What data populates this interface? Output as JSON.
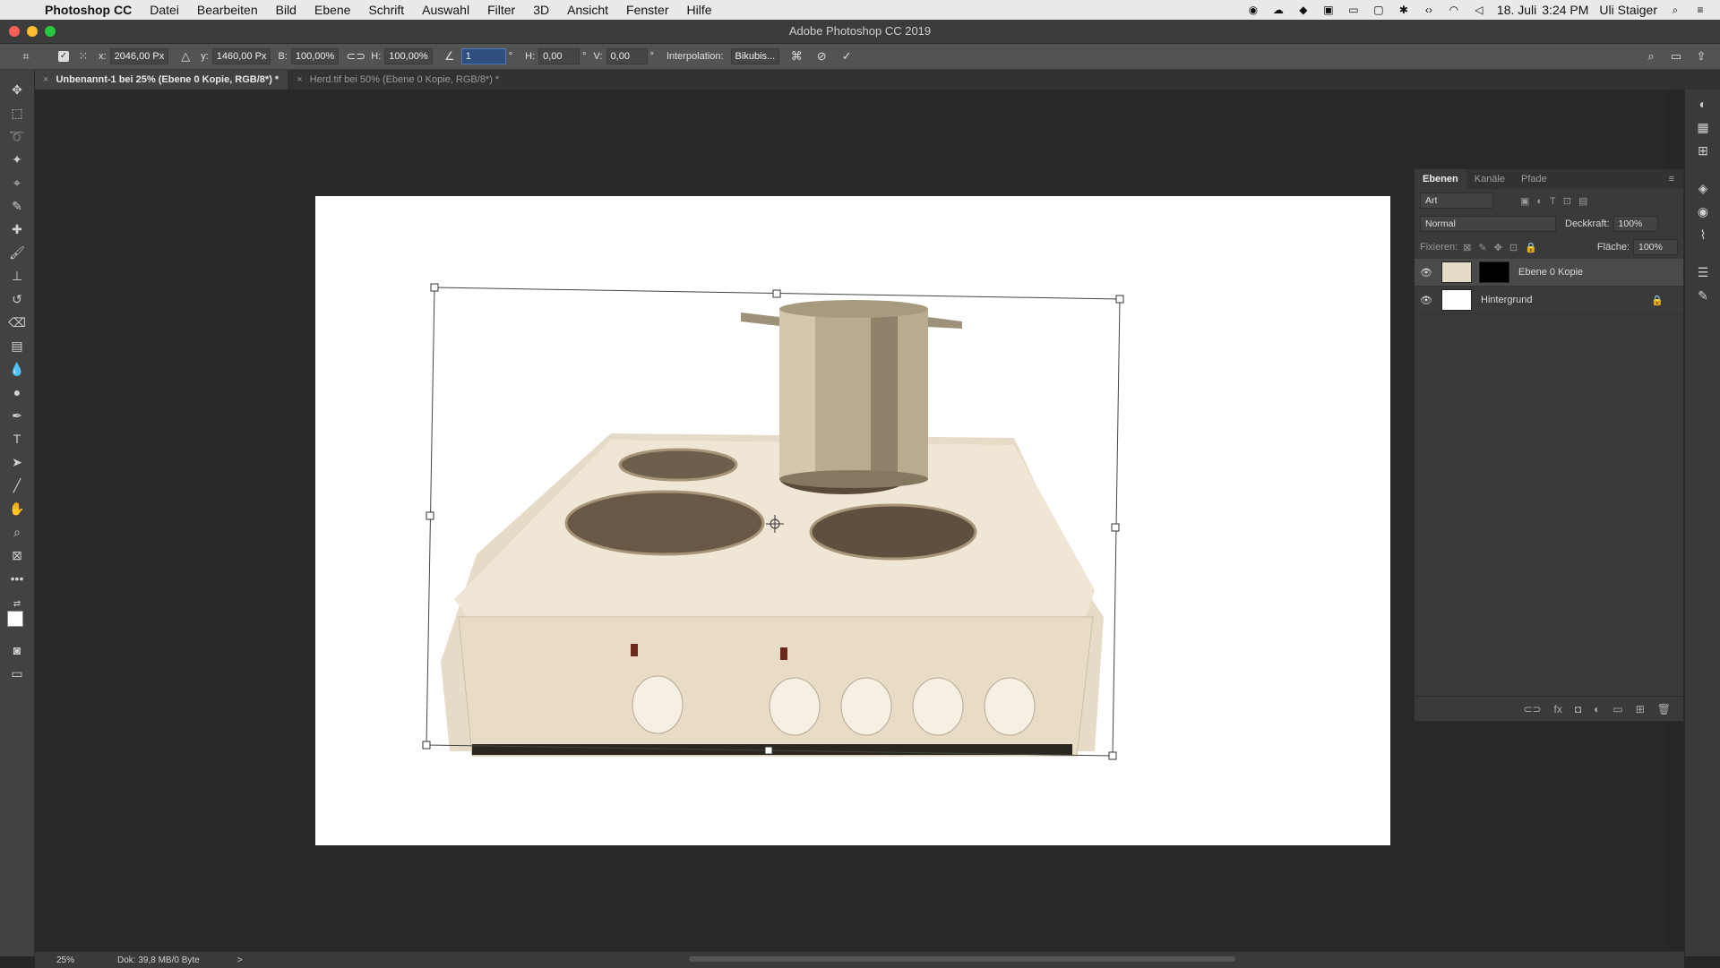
{
  "menubar": {
    "app_name": "Photoshop CC",
    "items": [
      "Datei",
      "Bearbeiten",
      "Bild",
      "Ebene",
      "Schrift",
      "Auswahl",
      "Filter",
      "3D",
      "Ansicht",
      "Fenster",
      "Hilfe"
    ],
    "date": "18. Juli",
    "time": "3:24 PM",
    "user": "Uli Staiger"
  },
  "window": {
    "title": "Adobe Photoshop CC 2019"
  },
  "options": {
    "x_label": "x:",
    "x_value": "2046,00 Px",
    "y_label": "y:",
    "y_value": "1460,00 Px",
    "w_label": "B:",
    "w_value": "100,00%",
    "h_label": "H:",
    "h_value": "100,00%",
    "angle_value": "1",
    "deg": "°",
    "hskew_label": "H:",
    "hskew_value": "0,00",
    "vskew_label": "V:",
    "vskew_value": "0,00",
    "interp_label": "Interpolation:",
    "interp_value": "Bikubis..."
  },
  "tabs": [
    {
      "label": "Unbenannt-1 bei 25% (Ebene 0 Kopie, RGB/8*) *",
      "active": true
    },
    {
      "label": "Herd.tif bei 50% (Ebene 0 Kopie, RGB/8*) *",
      "active": false
    }
  ],
  "layers_panel": {
    "tabs": [
      "Ebenen",
      "Kanäle",
      "Pfade"
    ],
    "search_placeholder": "Art",
    "blend_mode": "Normal",
    "opacity_label": "Deckkraft:",
    "opacity_value": "100%",
    "lock_label": "Fixieren:",
    "fill_label": "Fläche:",
    "fill_value": "100%",
    "layers": [
      {
        "name": "Ebene 0 Kopie",
        "selected": true
      },
      {
        "name": "Hintergrund",
        "selected": false
      }
    ]
  },
  "status": {
    "zoom": "25%",
    "doc": "Dok: 39,8 MB/0 Byte",
    "arrow": ">"
  },
  "colors": {
    "accent_red": "#ff5f57",
    "accent_yellow": "#febc2e",
    "accent_green": "#28c840"
  },
  "icons": [
    "apple-icon",
    "move-tool-icon",
    "marquee-tool-icon",
    "lasso-tool-icon",
    "magic-wand-icon",
    "crop-tool-icon",
    "eyedropper-icon",
    "healing-brush-icon",
    "brush-tool-icon",
    "stamp-tool-icon",
    "history-brush-icon",
    "eraser-icon",
    "gradient-icon",
    "blur-tool-icon",
    "dodge-tool-icon",
    "pen-tool-icon",
    "type-tool-icon",
    "path-select-icon",
    "line-tool-icon",
    "hand-tool-icon",
    "zoom-tool-icon",
    "frame-tool-icon",
    "more-tools-icon",
    "eye-icon",
    "lock-icon"
  ]
}
